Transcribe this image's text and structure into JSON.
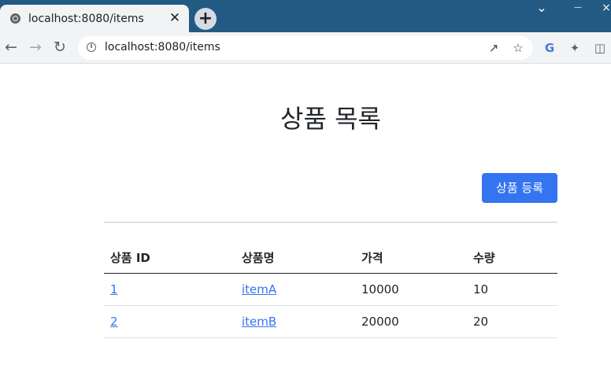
{
  "browser": {
    "tab_title": "localhost:8080/items",
    "tab_close": "✕",
    "new_tab": "+",
    "url": "localhost:8080/items",
    "window_controls": {
      "chevron": "⌄",
      "minimize": "—",
      "close": "×"
    }
  },
  "page": {
    "title": "상품 목록",
    "add_button_label": "상품 등록"
  },
  "table": {
    "headers": [
      "상품 ID",
      "상품명",
      "가격",
      "수량"
    ],
    "rows": [
      {
        "id": "1",
        "name": "itemA",
        "price": "10000",
        "quantity": "10"
      },
      {
        "id": "2",
        "name": "itemB",
        "price": "20000",
        "quantity": "20"
      }
    ]
  },
  "colors": {
    "tabstrip": "#235a84",
    "primary": "#3574f0",
    "link": "#3574f0"
  }
}
